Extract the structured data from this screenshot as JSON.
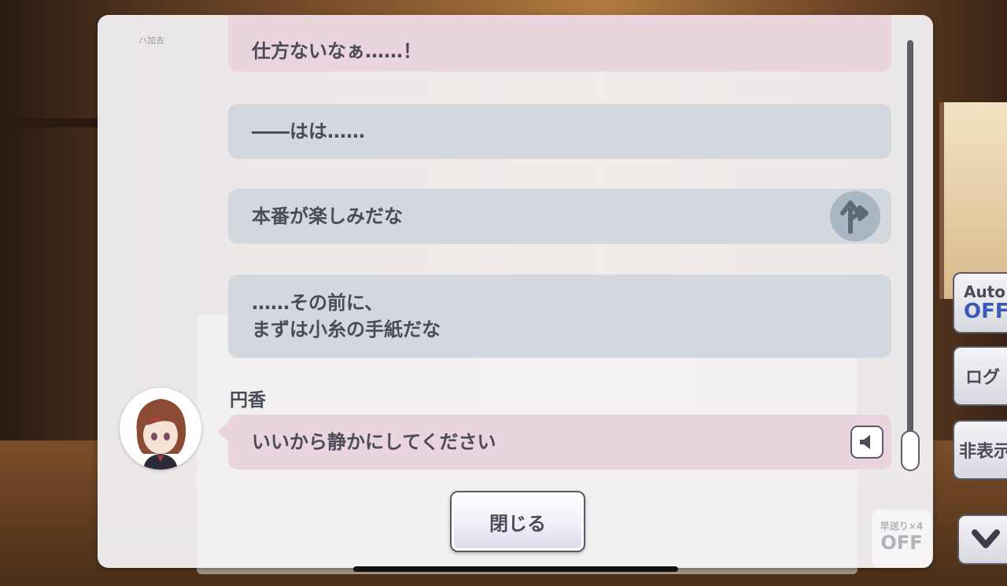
{
  "log": {
    "speaker_top": "ハ加去",
    "messages": [
      {
        "id": "m1",
        "text": "仕方ないなぁ……！",
        "style": "pink"
      },
      {
        "id": "m2",
        "text": "――はは……",
        "style": "grey"
      },
      {
        "id": "m3",
        "text": "本番が楽しみだな",
        "style": "grey",
        "choice_icon": "branch-arrow-icon"
      },
      {
        "id": "m4",
        "text": "……その前に、\nまずは小糸の手紙だな",
        "style": "grey"
      },
      {
        "id": "m5",
        "speaker": "円香",
        "text": "いいから静かにしてください",
        "style": "pink",
        "voice_icon": "speaker-icon"
      }
    ]
  },
  "buttons": {
    "close_label": "閉じる"
  },
  "side": {
    "auto_line1": "Auto",
    "auto_line2": "OFF",
    "log_label": "ログ",
    "hide_label": "非表示",
    "fastforward_line1": "早送り×4",
    "fastforward_line2": "OFF"
  },
  "colors": {
    "accent_blue": "#3a5ab8",
    "bubble_pink": "#ead5de",
    "bubble_grey": "#d3d7de",
    "text": "#4c4c58"
  }
}
